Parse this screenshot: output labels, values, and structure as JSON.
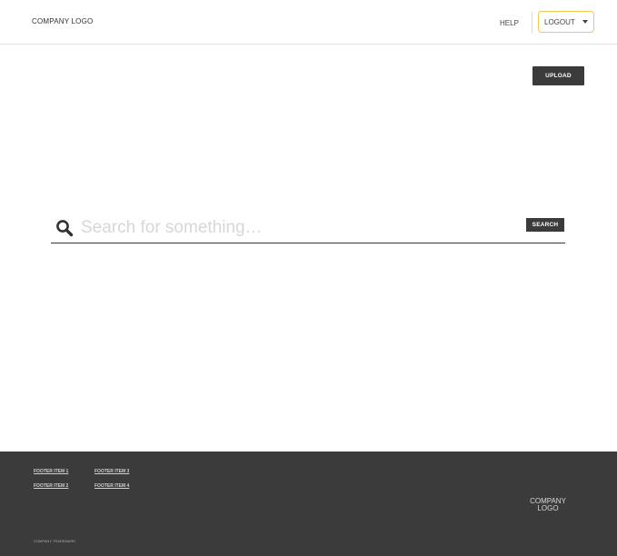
{
  "header": {
    "logo_text": "COMPANY LOGO",
    "help_label": "HELP",
    "logout_label": "LOGOUT"
  },
  "main": {
    "upload_label": "UPLOAD",
    "search": {
      "placeholder": "Search for something…",
      "value": "",
      "button_label": "SEARCH"
    }
  },
  "footer": {
    "links": [
      "FOOTER ITEM 1",
      "FOOTER ITEM 2",
      "FOOTER ITEM 3",
      "FOOTER ITEM 4"
    ],
    "logo_lines": [
      "COMPANY",
      "LOGO"
    ],
    "trademark": "COMPANY TRADEMARK"
  },
  "colors": {
    "dark": "#3b3b3b",
    "accent": "#f2c94c",
    "footer_text": "#d0d0d0"
  },
  "icons": {
    "search": "search-icon",
    "dropdown": "chevron-down-icon"
  }
}
